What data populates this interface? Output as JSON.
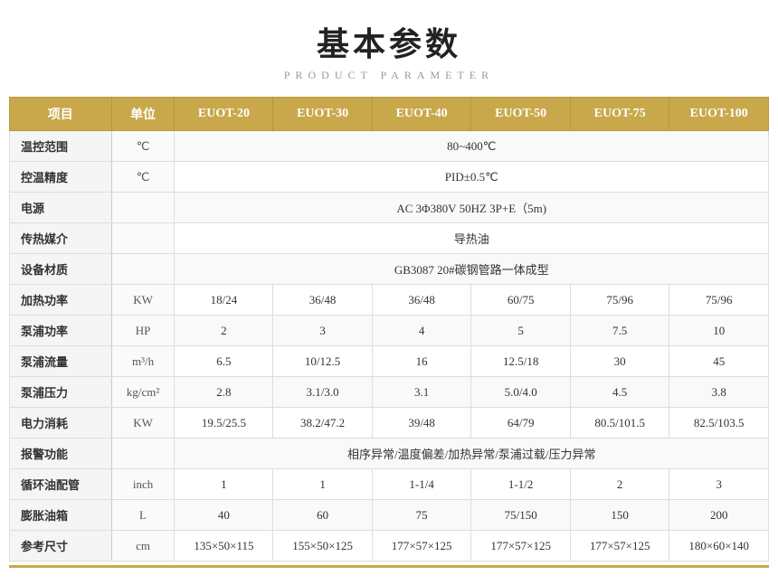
{
  "title": "基本参数",
  "subtitle": "PRODUCT PARAMETER",
  "header": {
    "cols": [
      "项目",
      "单位",
      "EUOT-20",
      "EUOT-30",
      "EUOT-40",
      "EUOT-50",
      "EUOT-75",
      "EUOT-100"
    ]
  },
  "rows": [
    {
      "label": "温控范围",
      "unit": "℃",
      "values": [
        "80~400℃"
      ],
      "colspan": 6
    },
    {
      "label": "控温精度",
      "unit": "℃",
      "values": [
        "PID±0.5℃"
      ],
      "colspan": 6
    },
    {
      "label": "电源",
      "unit": "",
      "values": [
        "AC 3Φ380V 50HZ 3P+E（5m)"
      ],
      "colspan": 7
    },
    {
      "label": "传热媒介",
      "unit": "",
      "values": [
        "导热油"
      ],
      "colspan": 7
    },
    {
      "label": "设备材质",
      "unit": "",
      "values": [
        "GB3087   20#碳钢管路一体成型"
      ],
      "colspan": 7
    },
    {
      "label": "加热功率",
      "unit": "KW",
      "values": [
        "18/24",
        "36/48",
        "36/48",
        "60/75",
        "75/96",
        "75/96"
      ],
      "colspan": 1
    },
    {
      "label": "泵浦功率",
      "unit": "HP",
      "values": [
        "2",
        "3",
        "4",
        "5",
        "7.5",
        "10"
      ],
      "colspan": 1
    },
    {
      "label": "泵浦流量",
      "unit": "m³/h",
      "values": [
        "6.5",
        "10/12.5",
        "16",
        "12.5/18",
        "30",
        "45"
      ],
      "colspan": 1
    },
    {
      "label": "泵浦压力",
      "unit": "kg/cm²",
      "values": [
        "2.8",
        "3.1/3.0",
        "3.1",
        "5.0/4.0",
        "4.5",
        "3.8"
      ],
      "colspan": 1
    },
    {
      "label": "电力消耗",
      "unit": "KW",
      "values": [
        "19.5/25.5",
        "38.2/47.2",
        "39/48",
        "64/79",
        "80.5/101.5",
        "82.5/103.5"
      ],
      "colspan": 1
    },
    {
      "label": "报警功能",
      "unit": "",
      "values": [
        "相序异常/温度偏差/加热异常/泵浦过载/压力异常"
      ],
      "colspan": 7
    },
    {
      "label": "循环油配管",
      "unit": "inch",
      "values": [
        "1",
        "1",
        "1-1/4",
        "1-1/2",
        "2",
        "3"
      ],
      "colspan": 1
    },
    {
      "label": "膨胀油箱",
      "unit": "L",
      "values": [
        "40",
        "60",
        "75",
        "75/150",
        "150",
        "200"
      ],
      "colspan": 1
    },
    {
      "label": "参考尺寸",
      "unit": "cm",
      "values": [
        "135×50×115",
        "155×50×125",
        "177×57×125",
        "177×57×125",
        "177×57×125",
        "180×60×140"
      ],
      "colspan": 1
    }
  ]
}
